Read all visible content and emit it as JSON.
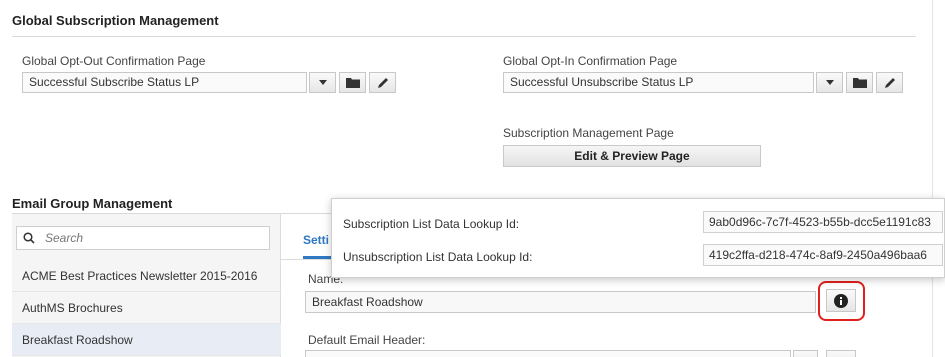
{
  "global_subscription": {
    "title": "Global Subscription Management",
    "opt_out": {
      "label": "Global Opt-Out Confirmation Page",
      "value": "Successful Subscribe Status LP"
    },
    "opt_in": {
      "label": "Global Opt-In Confirmation Page",
      "value": "Successful Unsubscribe Status LP"
    },
    "subscription_page": {
      "label": "Subscription Management Page",
      "button": "Edit & Preview Page"
    }
  },
  "email_group": {
    "title": "Email Group Management",
    "search_placeholder": "Search",
    "items": [
      {
        "label": "ACME Best Practices Newsletter 2015-2016"
      },
      {
        "label": "AuthMS Brochures"
      },
      {
        "label": "Breakfast Roadshow"
      }
    ],
    "tab_label": "Setti",
    "name_label": "Name:",
    "name_value": "Breakfast Roadshow",
    "default_header_label": "Default Email Header:"
  },
  "tooltip": {
    "rows": [
      {
        "label": "Subscription List Data Lookup Id:",
        "value": "9ab0d96c-7c7f-4523-b55b-dcc5e1191c83"
      },
      {
        "label": "Unsubscription List Data Lookup Id:",
        "value": "419c2ffa-d218-474c-8af9-2450a496baa6"
      }
    ]
  },
  "colors": {
    "highlight": "#e0201e",
    "tab_accent": "#2f78c4",
    "selected_row": "#e8edf5"
  },
  "icons": [
    "chevron-down-icon",
    "folder-icon",
    "pencil-icon",
    "search-icon",
    "info-icon"
  ]
}
